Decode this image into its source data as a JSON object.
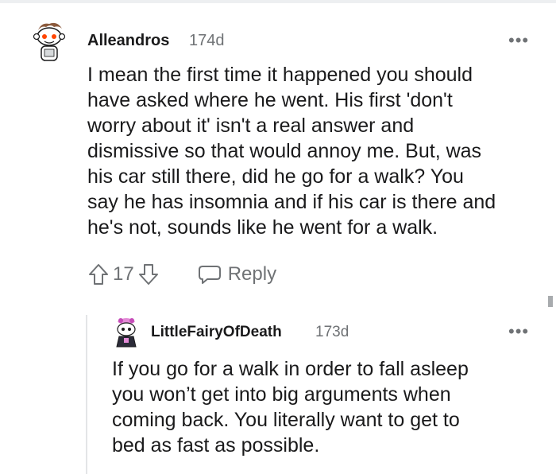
{
  "comment": {
    "username": "Alleandros",
    "age": "174d",
    "more": "•••",
    "lines": [
      "I mean the first time it happened you should",
      "have asked where he went. His first 'don't",
      "worry about it' isn't a real answer and",
      "dismissive so that would annoy me. But, was",
      "his car still there, did he go for a walk? You",
      "say he has insomnia and if his car is there and",
      "he's not, sounds like he went for a walk."
    ],
    "vote_count": "17",
    "reply_label": "Reply"
  },
  "reply": {
    "username": "LittleFairyOfDeath",
    "age": "173d",
    "more": "•••",
    "lines": [
      "If you go for a walk in order to fall asleep",
      "you won’t get into big arguments when",
      "coming back. You literally want to get to",
      "bed as fast as possible."
    ]
  },
  "colors": {
    "text": "#1a1a1b",
    "meta": "#6f7275",
    "thread_line": "#e3e5e7"
  }
}
